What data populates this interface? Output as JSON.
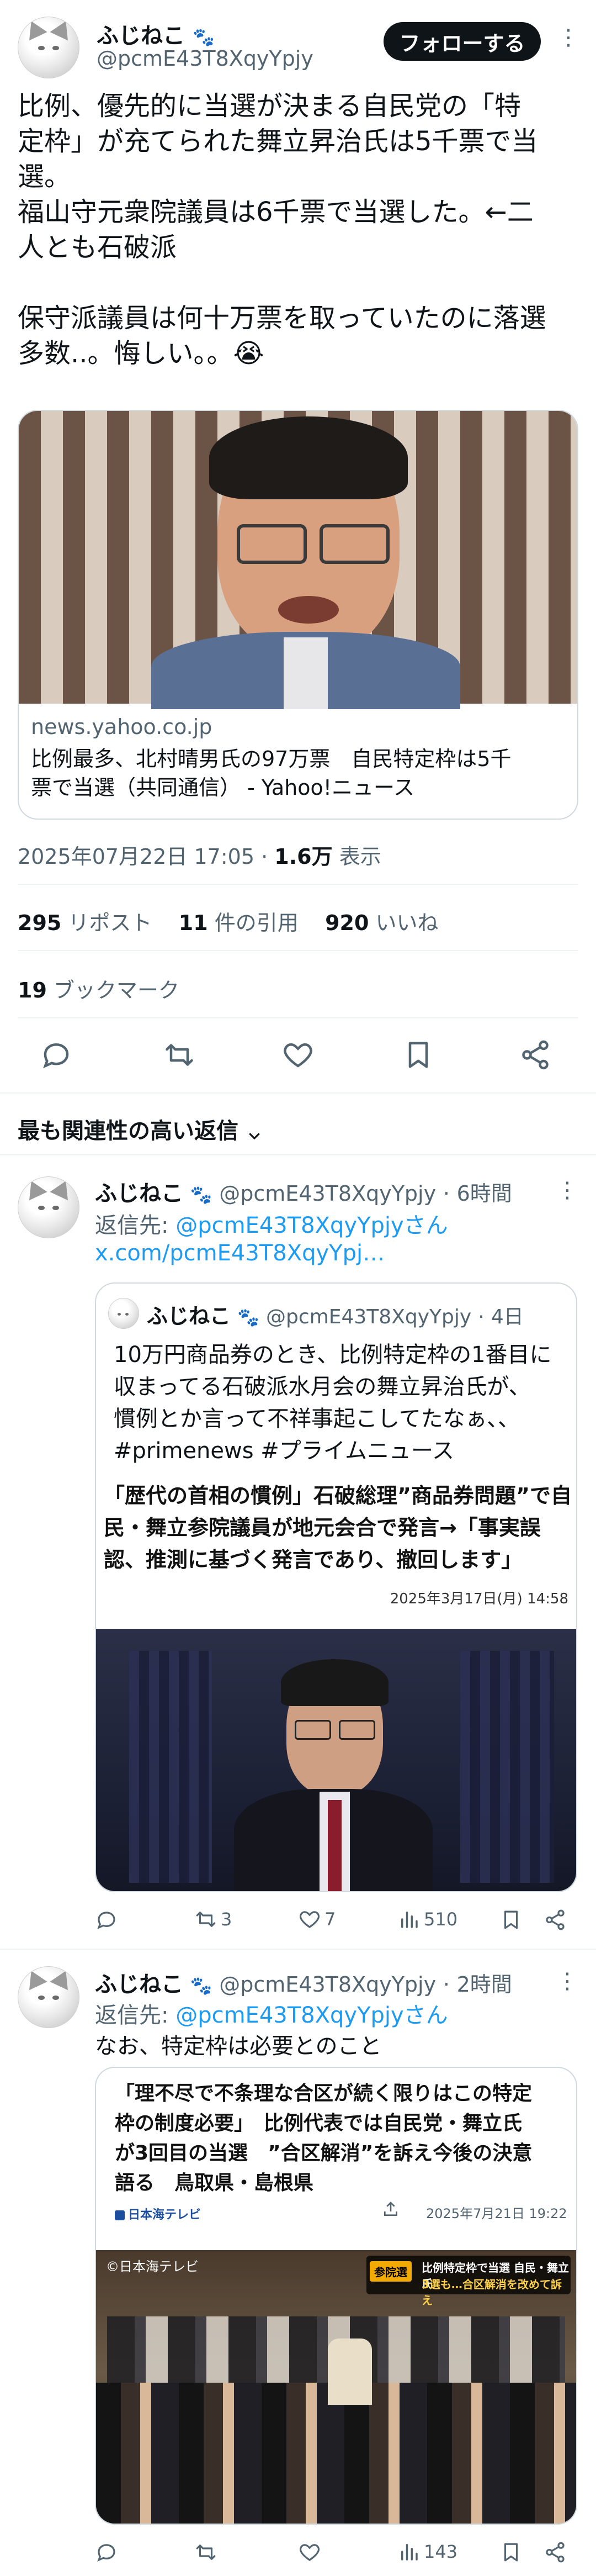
{
  "main_tweet": {
    "author_name": "ふじねこ",
    "author_handle": "@pcmE43T8XqyYpjy",
    "follow_label": "フォローする",
    "text_lines": [
      "比例、優先的に当選が決まる自民党の「特",
      "定枠」が充てられた舞立昇治氏は5千票で当",
      "選。",
      "福山守元衆院議員は6千票で当選した。←二",
      "人とも石破派",
      "",
      "保守派議員は何十万票を取っていたのに落選",
      "多数..。悔しい。。😭"
    ],
    "card_domain": "news.yahoo.co.jp",
    "card_title_lines": [
      "比例最多、北村晴男氏の97万票　自民特定枠は5千",
      "票で当選（共同通信） - Yahoo!ニュース"
    ],
    "timestamp": "2025年07月22日 17:05",
    "views_count": "1.6万",
    "views_label": "表示",
    "stats": {
      "reposts_count": "295",
      "reposts_label": "リポスト",
      "quotes_count": "11",
      "quotes_label": "件の引用",
      "likes_count": "920",
      "likes_label": "いいね",
      "bookmarks_count": "19",
      "bookmarks_label": "ブックマーク"
    }
  },
  "replies_sort_label": "最も関連性の高い返信",
  "reply1": {
    "author_name": "ふじねこ",
    "author_handle": "@pcmE43T8XqyYpjy",
    "time": "6時間",
    "reply_to_label": "返信先:",
    "reply_to_handle": "@pcmE43T8XqyYpjyさん",
    "link_text": "x.com/pcmE43T8XqyYpj…",
    "quote": {
      "author_name": "ふじねこ",
      "author_handle": "@pcmE43T8XqyYpjy",
      "time": "4日",
      "text_lines": [
        "10万円商品券のとき、比例特定枠の1番目に",
        "収まってる石破派水月会の舞立昇治氏が、",
        "慣例とか言って不祥事起こしてたなぁ、、",
        "#primenews #プライムニュース"
      ],
      "headline_lines": [
        "「歴代の首相の慣例」石破総理”商品券問題”で自",
        "民・舞立参院議員が地元会合で発言→「事実誤",
        "認、推測に基づく発言であり、撤回します」"
      ],
      "headline_date": "2025年3月17日(月) 14:58"
    },
    "actions": {
      "reposts": "3",
      "likes": "7",
      "views": "510"
    }
  },
  "reply2": {
    "author_name": "ふじねこ",
    "author_handle": "@pcmE43T8XqyYpjy",
    "time": "2時間",
    "reply_to_label": "返信先:",
    "reply_to_handle": "@pcmE43T8XqyYpjyさん",
    "text": "なお、特定枠は必要とのこと",
    "embed": {
      "title_lines": [
        "「理不尽で不条理な合区が続く限りはこの特定",
        "枠の制度必要」　比例代表では自民党・舞立氏",
        "が3回目の当選　”合区解消”を訴え今後の決意",
        "語る　鳥取県・島根県"
      ],
      "source": "日本海テレビ",
      "date": "2025年7月21日 19:22",
      "photo_credit": "©日本海テレビ",
      "banner_tag": "参院選",
      "banner_line1": "比例特定枠で当選 自民・舞立氏",
      "banner_line2": "3選も…合区解消を改めて訴え"
    },
    "actions": {
      "views": "143"
    }
  },
  "colors": {
    "accent": "#1d9bf0",
    "text": "#0f1419",
    "muted": "#536471",
    "border": "#cfd9de"
  }
}
